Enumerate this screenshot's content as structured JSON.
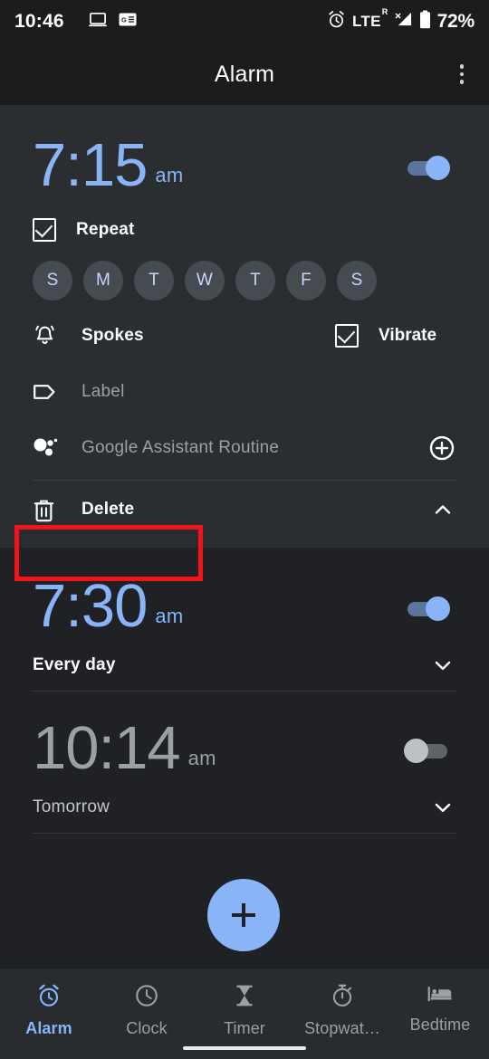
{
  "status_bar": {
    "time": "10:46",
    "left_icons": [
      "laptop-icon",
      "google-pay-card-icon"
    ],
    "right_icons": [
      "alarm-icon",
      "signal-icon",
      "battery-icon"
    ],
    "network": "LTE",
    "network_sup": "R",
    "battery_percent": "72%"
  },
  "app_bar": {
    "title": "Alarm",
    "overflow_icon": "more-vert-icon"
  },
  "alarms": [
    {
      "time": "7:15",
      "meridiem": "am",
      "enabled": true,
      "expanded": true,
      "repeat_label": "Repeat",
      "repeat_checked": true,
      "days": [
        "S",
        "M",
        "T",
        "W",
        "T",
        "F",
        "S"
      ],
      "ringtone": "Spokes",
      "vibrate_label": "Vibrate",
      "vibrate_checked": true,
      "label_placeholder": "Label",
      "assistant_routine": "Google Assistant Routine",
      "add_routine_icon": "plus-circle-icon",
      "delete_label": "Delete",
      "collapse_icon": "chevron-up-icon"
    },
    {
      "time": "7:30",
      "meridiem": "am",
      "enabled": true,
      "expanded": false,
      "schedule": "Every day",
      "expand_icon": "chevron-down-icon"
    },
    {
      "time": "10:14",
      "meridiem": "am",
      "enabled": false,
      "expanded": false,
      "schedule": "Tomorrow",
      "expand_icon": "chevron-down-icon"
    }
  ],
  "fab": {
    "icon": "plus-icon",
    "aria_label": "Add alarm"
  },
  "bottom_nav": {
    "items": [
      {
        "label": "Alarm",
        "icon": "alarm-clock-icon",
        "active": true
      },
      {
        "label": "Clock",
        "icon": "clock-icon",
        "active": false
      },
      {
        "label": "Timer",
        "icon": "hourglass-icon",
        "active": false
      },
      {
        "label": "Stopwat…",
        "icon": "stopwatch-icon",
        "active": false
      },
      {
        "label": "Bedtime",
        "icon": "bed-icon",
        "active": false
      }
    ]
  },
  "annotation": {
    "type": "highlight-rectangle",
    "target": "Delete",
    "color": "#f3131a"
  },
  "colors": {
    "accent": "#8ab4f8",
    "page_background": "#202124",
    "card_background": "#2b2e31",
    "appbar_background": "#1b1c1e",
    "disabled_text": "#9aa0a6",
    "nav_background": "#292c2f"
  }
}
